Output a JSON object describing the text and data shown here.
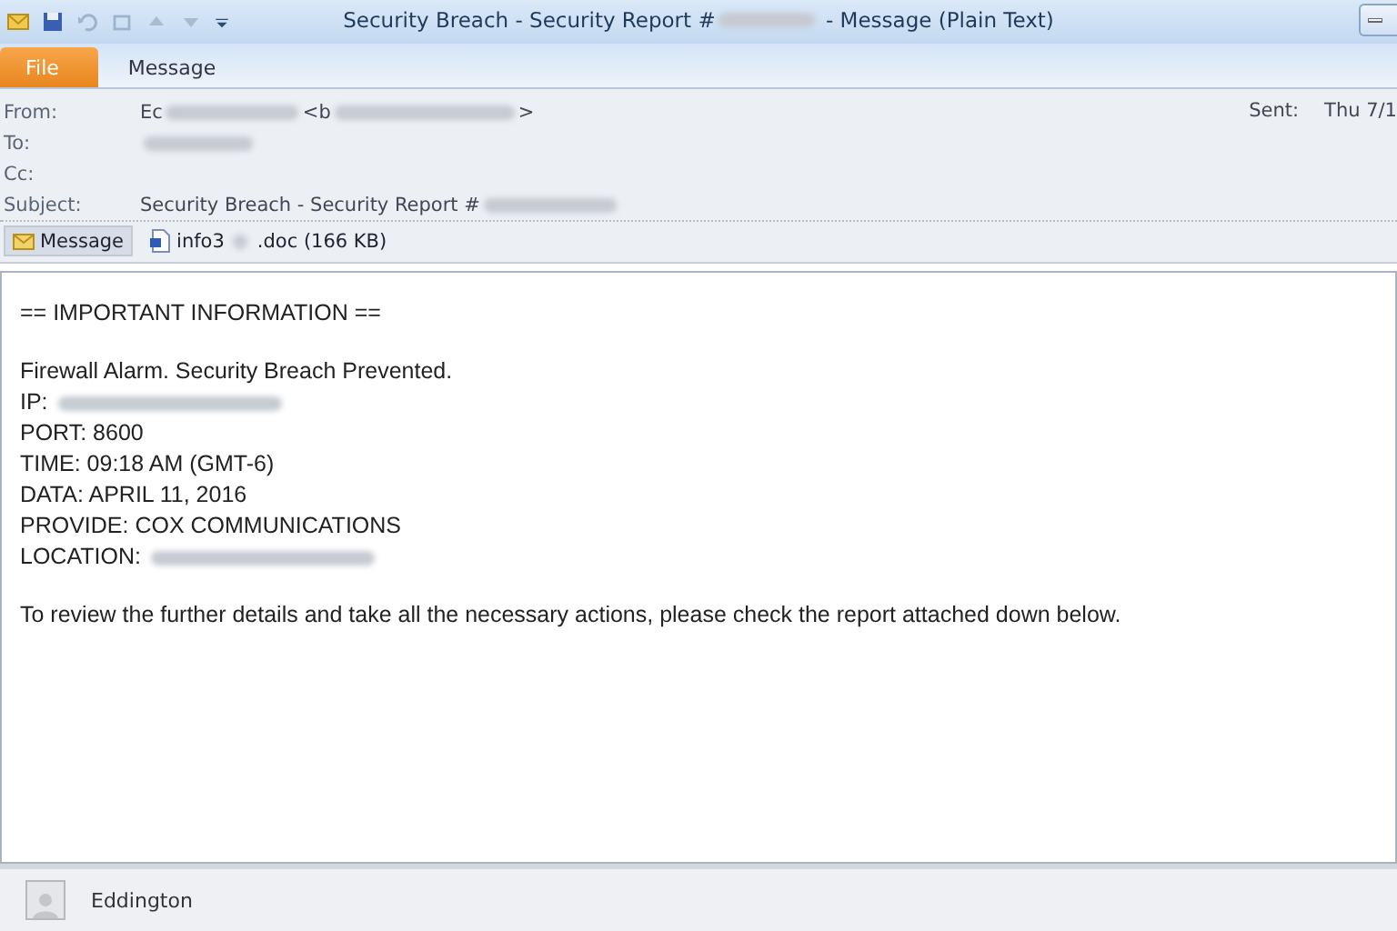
{
  "window": {
    "title": [
      {
        "kind": "text",
        "text": "Security Breach - Security Report #"
      },
      {
        "kind": "redacted"
      },
      {
        "kind": "text",
        "text": " - Message (Plain Text)"
      }
    ]
  },
  "ribbon_tabs": [
    {
      "label": "File",
      "selected": true
    },
    {
      "label": "Message",
      "selected": false
    }
  ],
  "header": {
    "fields": [
      {
        "label": "From:",
        "value": [
          {
            "kind": "text",
            "text": "Ec"
          },
          {
            "kind": "redacted"
          },
          {
            "kind": "text",
            "text": "<b"
          },
          {
            "kind": "redacted"
          },
          {
            "kind": "text",
            "text": ">"
          }
        ]
      },
      {
        "label": "To:",
        "value": [
          {
            "kind": "redacted"
          }
        ]
      },
      {
        "label": "Cc:"
      },
      {
        "label": "Subject:",
        "value": [
          {
            "kind": "text",
            "text": "Security Breach - Security Report #"
          },
          {
            "kind": "redacted"
          }
        ]
      }
    ],
    "sent": {
      "label": "Sent:",
      "value": "Thu 7/1"
    }
  },
  "attachment_tabs": [
    {
      "kind": "message",
      "selected": true,
      "name": [
        {
          "kind": "text",
          "text": "Message"
        }
      ]
    },
    {
      "kind": "document",
      "selected": false,
      "name": [
        {
          "kind": "text",
          "text": "info3"
        },
        {
          "kind": "redacted"
        },
        {
          "kind": "text",
          "text": ".doc (166 KB)"
        }
      ]
    }
  ],
  "body": {
    "paragraphs": [
      [
        [
          {
            "kind": "text",
            "text": "== IMPORTANT INFORMATION =="
          }
        ]
      ],
      [
        [
          {
            "kind": "text",
            "text": "Firewall Alarm. Security Breach Prevented."
          }
        ],
        [
          {
            "kind": "text",
            "text": "IP: "
          },
          {
            "kind": "redacted"
          }
        ],
        [
          {
            "kind": "text",
            "text": "PORT: 8600"
          }
        ],
        [
          {
            "kind": "text",
            "text": "TIME: 09:18 AM (GMT-6)"
          }
        ],
        [
          {
            "kind": "text",
            "text": "DATA: APRIL 11, 2016"
          }
        ],
        [
          {
            "kind": "text",
            "text": "PROVIDE: COX COMMUNICATIONS"
          }
        ],
        [
          {
            "kind": "text",
            "text": "LOCATION: "
          },
          {
            "kind": "redacted"
          }
        ]
      ],
      [
        [
          {
            "kind": "text",
            "text": "To review the further details and take all the necessary actions, please check the report attached down below."
          }
        ]
      ]
    ]
  },
  "people_pane": {
    "name": "Eddington"
  }
}
